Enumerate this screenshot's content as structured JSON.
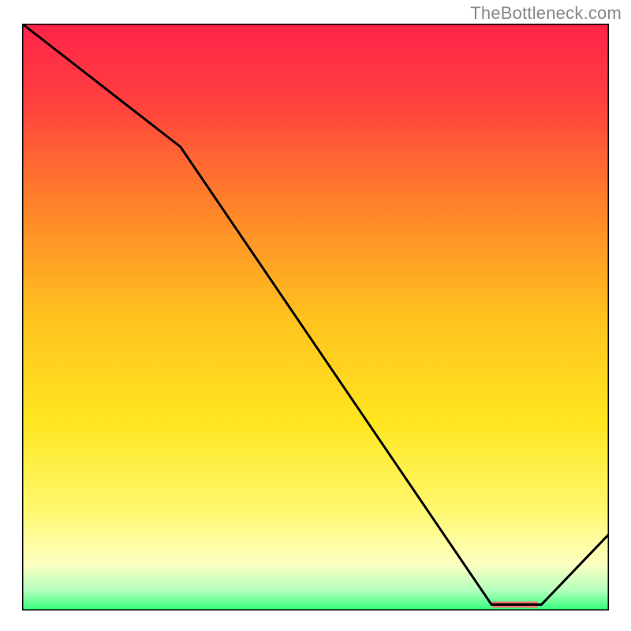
{
  "watermark": "TheBottleneck.com",
  "chart_data": {
    "type": "line",
    "title": "",
    "xlabel": "",
    "ylabel": "",
    "xlim": [
      0,
      1
    ],
    "ylim": [
      0,
      1
    ],
    "grid": false,
    "legend": false,
    "line_points": [
      {
        "x": 0.0,
        "y": 1.0
      },
      {
        "x": 0.27,
        "y": 0.79
      },
      {
        "x": 0.8,
        "y": 0.01
      },
      {
        "x": 0.885,
        "y": 0.01
      },
      {
        "x": 1.0,
        "y": 0.13
      }
    ],
    "highlight_bar": {
      "x0": 0.8,
      "x1": 0.88,
      "y": 0.01
    },
    "gradient_stops": [
      {
        "offset": 0.0,
        "color": "#ff2449"
      },
      {
        "offset": 0.13,
        "color": "#ff3f3f"
      },
      {
        "offset": 0.3,
        "color": "#ff7f2a"
      },
      {
        "offset": 0.5,
        "color": "#ffc21f"
      },
      {
        "offset": 0.68,
        "color": "#ffe620"
      },
      {
        "offset": 0.83,
        "color": "#fff870"
      },
      {
        "offset": 0.92,
        "color": "#fdffc0"
      },
      {
        "offset": 0.965,
        "color": "#b6ffbe"
      },
      {
        "offset": 1.0,
        "color": "#2fff7a"
      }
    ],
    "border_color": "#000000",
    "line_color": "#000000",
    "highlight_color": "#ee7070"
  }
}
